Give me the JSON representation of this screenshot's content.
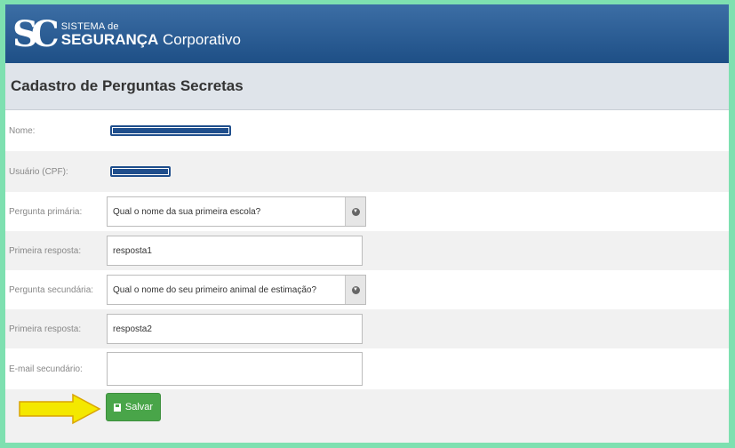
{
  "brand": {
    "mark": "SC",
    "line1": "SISTEMA de",
    "line2_bold": "SEGURANÇA",
    "line2_rest": "Corporativo"
  },
  "page_title": "Cadastro de Perguntas Secretas",
  "form": {
    "nome_label": "Nome:",
    "cpf_label": "Usuário (CPF):",
    "pergunta_primaria_label": "Pergunta primária:",
    "pergunta_primaria_value": "Qual o nome da sua primeira escola?",
    "primeira_resposta_label": "Primeira resposta:",
    "primeira_resposta_value": "resposta1",
    "pergunta_secundaria_label": "Pergunta secundária:",
    "pergunta_secundaria_value": "Qual o nome do seu primeiro animal de estimação?",
    "segunda_resposta_label": "Primeira resposta:",
    "segunda_resposta_value": "resposta2",
    "email_label": "E-mail secundário:",
    "email_value": "",
    "save_label": "Salvar"
  },
  "colors": {
    "header": "#1e4f86",
    "save_button": "#49a549",
    "arrow": "#f4e800",
    "redaction": "#1f4e8c"
  }
}
